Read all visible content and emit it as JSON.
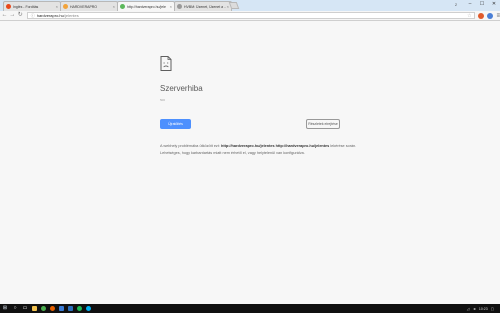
{
  "browser": {
    "tabs": [
      {
        "label": "Inglés - Fordítás",
        "favicon_color": "#e8491d",
        "active": false
      },
      {
        "label": "HARDVERAPRO",
        "favicon_color": "#f2a33a",
        "active": false
      },
      {
        "label": "http://hardverapro.hu/jele",
        "favicon_color": "#5cb85c",
        "active": true
      },
      {
        "label": "HVBM: Üzenet, Üzenet a ...",
        "favicon_color": "#999999",
        "active": false
      }
    ],
    "address": {
      "host": "hardverapro.hu",
      "path": "/jelentes"
    },
    "user_label": "2",
    "window_controls": {
      "minimize": "–",
      "maximize": "☐",
      "close": "✕"
    }
  },
  "error": {
    "title": "Szerverhiba",
    "code": "500",
    "reload_label": "Újratöltés",
    "details_label": "Részletek elrejtése",
    "message_parts": {
      "p1": "A webhely problémába ütközött ezt: ",
      "url1": "http://hardverapro.hu/jelentes",
      "p2": " ",
      "url2": "http://hardverapro.hu/jelentes",
      "p3": " lekérése során. Lehetséges, hogy karbantartás miatt nem érhető el, vagy helytelenül van konfigurálva."
    }
  },
  "taskbar": {
    "apps": [
      {
        "name": "file-explorer",
        "color": "#f2c24f"
      },
      {
        "name": "chrome",
        "color": "#4caf50"
      },
      {
        "name": "firefox",
        "color": "#e66000"
      },
      {
        "name": "store",
        "color": "#3a7bd5"
      },
      {
        "name": "mail",
        "color": "#2a6ebb"
      },
      {
        "name": "spotify",
        "color": "#1db954"
      },
      {
        "name": "skype",
        "color": "#00aff0"
      }
    ],
    "time": "10:23"
  },
  "colors": {
    "accent": "#4d90fe",
    "taskbar": "#101010"
  }
}
